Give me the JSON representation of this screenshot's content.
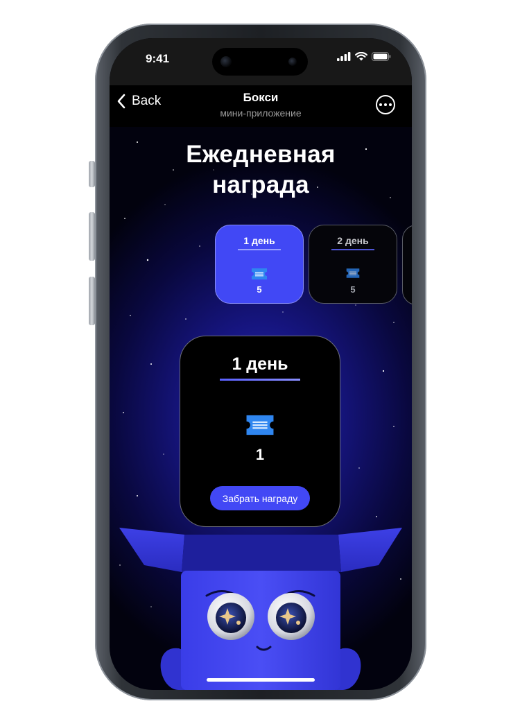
{
  "status_bar": {
    "time": "9:41"
  },
  "nav": {
    "back_label": "Back",
    "title": "Бокси",
    "subtitle": "мини-приложение"
  },
  "heading": {
    "line1": "Ежедневная",
    "line2": "награда"
  },
  "days": [
    {
      "label": "1 день",
      "quantity": "5",
      "state": "active"
    },
    {
      "label": "2 день",
      "quantity": "5",
      "state": "idle"
    }
  ],
  "reward_card": {
    "title": "1 день",
    "quantity": "1",
    "claim_label": "Забрать награду"
  },
  "colors": {
    "accent": "#4248f5",
    "background": "#02020e",
    "card_border": "#6d6f78",
    "ticket": "#2f86f0"
  },
  "icons": [
    "chevron-left-icon",
    "more-icon",
    "ticket-icon",
    "signal-icon",
    "wifi-icon",
    "battery-icon"
  ]
}
